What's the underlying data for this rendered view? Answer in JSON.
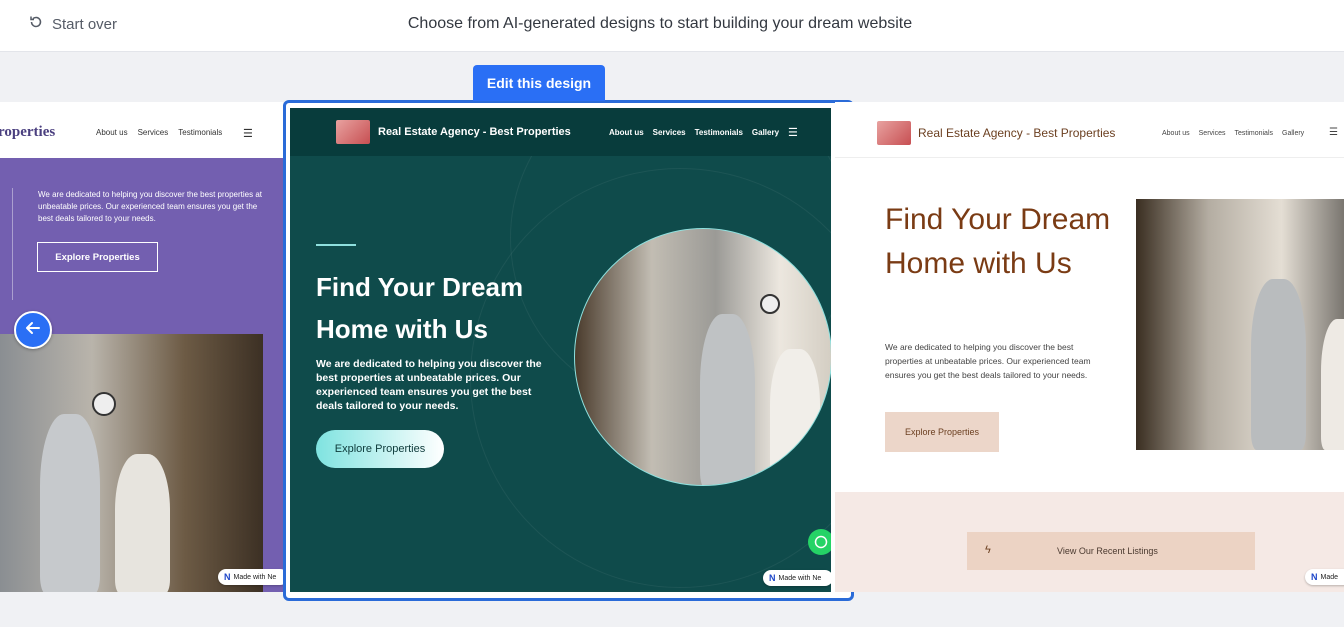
{
  "header": {
    "start_over_label": "Start over",
    "title": "Choose from AI-generated designs to start building your dream website"
  },
  "edit_button_label": "Edit this design",
  "left_design": {
    "logo": "roperties",
    "nav": [
      "About us",
      "Services",
      "Testimonials"
    ],
    "hero_text": "We are dedicated to helping you discover the best properties at unbeatable prices. Our experienced team ensures you get the best deals tailored to your needs.",
    "cta": "Explore Properties",
    "badge": "Made with Ne"
  },
  "middle_design": {
    "logo": "Real Estate Agency - Best Properties",
    "nav": [
      "About us",
      "Services",
      "Testimonials",
      "Gallery"
    ],
    "hero_title": "Find Your Dream Home with Us",
    "hero_text": "We are dedicated to helping you discover the best properties at unbeatable prices. Our experienced team ensures you get the best deals tailored to your needs.",
    "cta": "Explore Properties",
    "badge": "Made with Ne"
  },
  "right_design": {
    "logo": "Real Estate Agency - Best Properties",
    "nav": [
      "About us",
      "Services",
      "Testimonials",
      "Gallery"
    ],
    "hero_title": "Find Your Dream Home with Us",
    "hero_text": "We are dedicated to helping you discover the best properties at unbeatable prices. Our experienced team ensures you get the best deals tailored to your needs.",
    "cta": "Explore Properties",
    "listings_label": "View Our Recent Listings",
    "badge": "Made"
  },
  "icons": {
    "start_over": "refresh-icon",
    "back": "arrow-left-icon",
    "menu": "hamburger-icon",
    "whatsapp": "whatsapp-icon",
    "listing": "bolt-icon"
  },
  "colors": {
    "accent": "#2a6ff5",
    "left_hero": "#735fb0",
    "middle_hero": "#0f4b4b",
    "right_title": "#7a3b14"
  }
}
